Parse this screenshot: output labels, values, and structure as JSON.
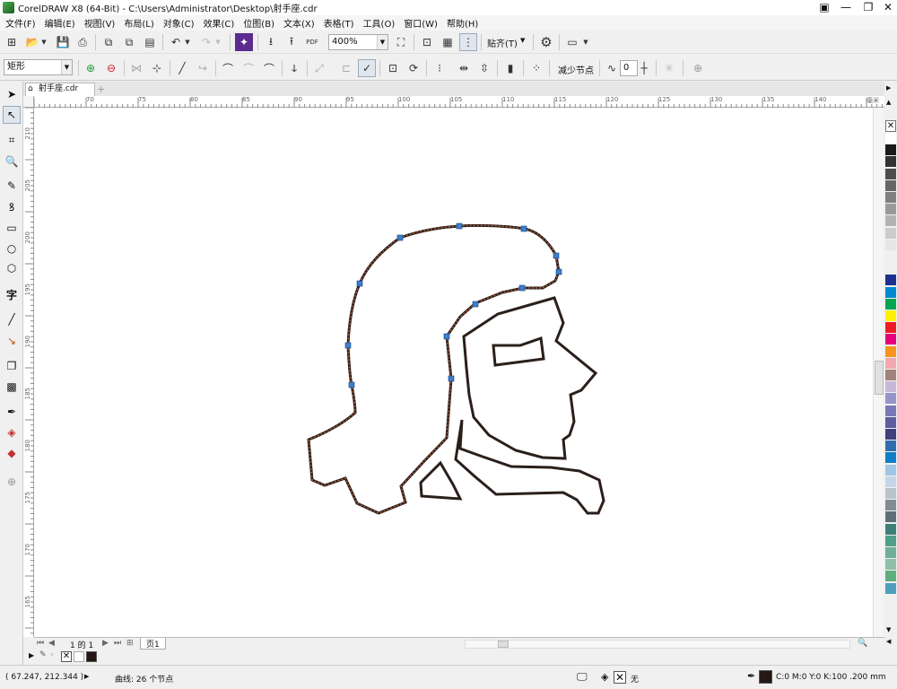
{
  "window": {
    "title": "CorelDRAW X8 (64-Bit) - C:\\Users\\Administrator\\Desktop\\射手座.cdr",
    "minimize": "—",
    "restore": "❐",
    "close": "✕"
  },
  "menu": [
    "文件(F)",
    "编辑(E)",
    "视图(V)",
    "布局(L)",
    "对象(C)",
    "效果(C)",
    "位图(B)",
    "文本(X)",
    "表格(T)",
    "工具(O)",
    "窗口(W)",
    "帮助(H)"
  ],
  "toolbar1": {
    "zoom": "400%",
    "snap": "贴齐(T)",
    "pdf_label": "PDF"
  },
  "toolbar2": {
    "shape_select": "矩形",
    "reduce_nodes": "减少节点",
    "smooth_value": "0"
  },
  "document": {
    "tab_name": "射手座.cdr",
    "add_tab": "+"
  },
  "ruler": {
    "h_ticks": [
      "70",
      "75",
      "80",
      "85",
      "90",
      "95",
      "100",
      "105",
      "110",
      "115",
      "120",
      "125",
      "130",
      "135",
      "140"
    ],
    "h_unit": "毫米",
    "v_ticks": [
      "210",
      "205",
      "200",
      "195",
      "190",
      "185",
      "180",
      "175",
      "170",
      "165"
    ]
  },
  "pagebar": {
    "page_count": "1 的 1",
    "page_tab": "页1"
  },
  "status": {
    "coords": "( 67.247, 212.344 )",
    "object_info": "曲线: 26 个节点",
    "fill_none": "无",
    "outline_info": "C:0 M:0 Y:0 K:100  .200 mm"
  },
  "colors": {
    "accent": "#1a7bc9",
    "path_outline": "#2a1f1a",
    "path_dashed": "#c0603a",
    "node": "#3b7fd1"
  },
  "palette": [
    "#ffffff",
    "#1a1a1a",
    "#333333",
    "#4d4d4d",
    "#666666",
    "#808080",
    "#999999",
    "#b3b3b3",
    "#cccccc",
    "#e6e6e6",
    "#f0f0f0",
    "#f0f0f0",
    "#1f2f8f",
    "#0089d0",
    "#00a650",
    "#fff200",
    "#ed1c24",
    "#e6007e",
    "#f7941d",
    "#f2a8b0",
    "#a0837a",
    "#c8b8d8",
    "#9595c9",
    "#7878b8",
    "#5d5d9f",
    "#40407f",
    "#2f6fad",
    "#0c7fc6",
    "#9fc6e6",
    "#c4d7e8",
    "#b8c4cc",
    "#7f8c94",
    "#5f6f78",
    "#3f7f7a",
    "#4f9f8a",
    "#6fae9a",
    "#8fbfa8",
    "#5fae7f",
    "#4f9fbf"
  ]
}
